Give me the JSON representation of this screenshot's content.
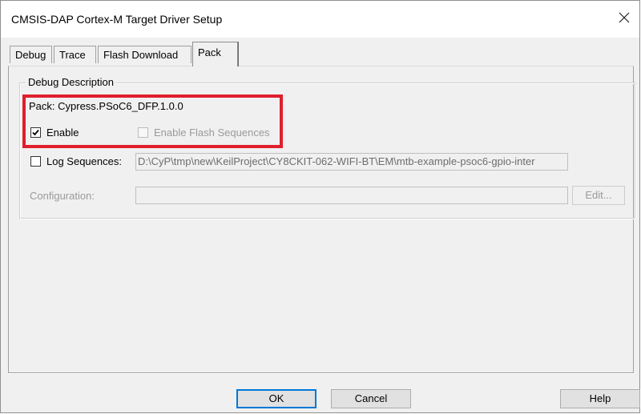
{
  "window": {
    "title": "CMSIS-DAP Cortex-M Target Driver Setup",
    "close_icon": "close-icon"
  },
  "tabs": [
    {
      "label": "Debug"
    },
    {
      "label": "Trace"
    },
    {
      "label": "Flash Download"
    },
    {
      "label": "Pack"
    }
  ],
  "active_tab": "Pack",
  "group": {
    "legend": "Debug Description",
    "pack_text": "Pack: Cypress.PSoC6_DFP.1.0.0",
    "enable_label": "Enable",
    "enable_checked": true,
    "enable_flash_label": "Enable Flash Sequences",
    "enable_flash_checked": false,
    "log_label": "Log Sequences:",
    "log_checked": false,
    "log_path": "D:\\CyP\\tmp\\new\\KeilProject\\CY8CKIT-062-WIFI-BT\\EM\\mtb-example-psoc6-gpio-inter",
    "config_label": "Configuration:",
    "config_value": "",
    "edit_label": "Edit..."
  },
  "buttons": {
    "ok": "OK",
    "cancel": "Cancel",
    "help": "Help"
  },
  "colors": {
    "highlight": "#e01e2c",
    "dialog_bg": "#f0f0f0",
    "default_button_border": "#0078d7"
  }
}
